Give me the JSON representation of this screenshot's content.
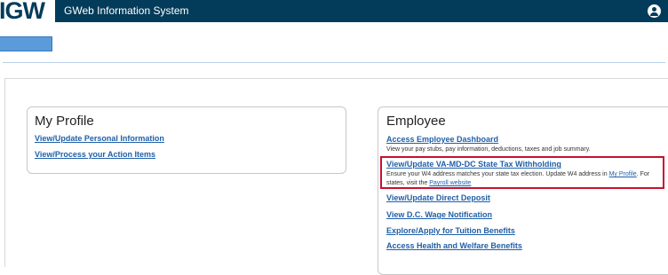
{
  "header": {
    "logo_text": "IGW",
    "app_title": "GWeb Information System",
    "user_icon": "user-icon"
  },
  "profile": {
    "title": "My Profile",
    "links": [
      "View/Update Personal Information",
      "View/Process your Action Items"
    ]
  },
  "employee": {
    "title": "Employee",
    "dashboard": {
      "label": "Access Employee Dashboard",
      "desc": "View your pay stubs, pay information, deductions, taxes and job summary."
    },
    "tax": {
      "label": "View/Update VA-MD-DC State Tax Withholding",
      "desc_part1": "Ensure your W4 address matches your state tax election. Update W4 address in ",
      "profile_link": "My Profile",
      "desc_part2": ". For",
      "desc_line2": "states, visit the ",
      "payroll_link": "Payroll website"
    },
    "links": [
      "View/Update Direct Deposit",
      "View D.C. Wage Notification",
      "Explore/Apply for Tuition Benefits",
      "Access Health and Welfare Benefits"
    ]
  },
  "colors": {
    "header_bg": "#033c5a",
    "link": "#1f5fa8",
    "highlight": "#c8102e",
    "button": "#5b9bd9"
  }
}
